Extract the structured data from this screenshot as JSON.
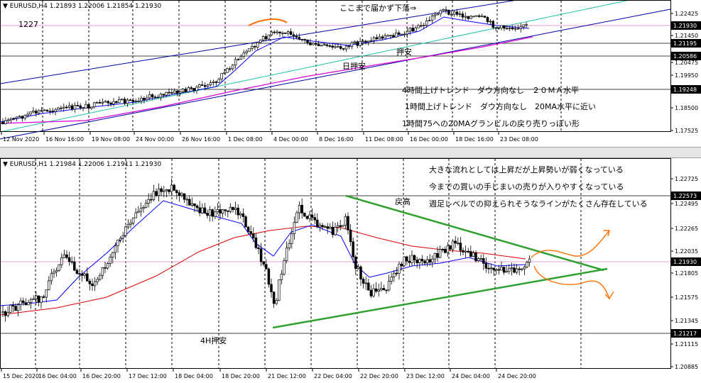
{
  "colors": {
    "candle": "#000000",
    "ma_short": "#0000ff",
    "ma_mid": "#dc0000",
    "ma_long": "#d400d4",
    "channel": "#0000a0",
    "mid_line": "#20c0a0",
    "triangle": "#30a030",
    "orange": "#ff7000",
    "current_line": "#e8a0d0",
    "hline": "#000000"
  },
  "top_chart": {
    "header": "▼ EURUSD,H4  1.21893 1.22006 1.21854 1.21930",
    "price_axis_labels": [
      "1.22425",
      "1.21930",
      "1.21450",
      "1.21195",
      "1.20586",
      "1.20475",
      "1.19950",
      "1.19248",
      "1.18500",
      "1.17525"
    ],
    "boxed_prices": [
      "1.21930",
      "1.21195",
      "1.20586",
      "1.19248"
    ],
    "time_labels": [
      "12 Nov 2020",
      "16 Nov 16:00",
      "19 Nov 08:00",
      "24 Nov 00:00",
      "26 Nov 16:00",
      "1 Dec 08:00",
      "4 Dec 00:00",
      "8 Dec 16:00",
      "11 Dec 08:00",
      "16 Dec 00:00",
      "18 Dec 16:00",
      "23 Dec 08:00"
    ],
    "annotations": {
      "top_note": "ここまで届かず下落⇒",
      "label_1227": "1227",
      "push_low": "押安",
      "daily_push_low": "日押安",
      "note1": "4時間上げトレンド　ダウ方向なし　２０ＭＡ水平",
      "note2": "1時間上げトレンド　ダウ方向なし　20MA水平に近い",
      "note3": "1時間75への20MAグランビルの戻り売りっぽい形"
    }
  },
  "bottom_chart": {
    "header": "▼ EURUSD,H1  1.21984 1.22006 1.21911 1.21930",
    "price_axis_labels": [
      "1.22725",
      "1.22573",
      "1.22495",
      "1.22265",
      "1.22035",
      "1.21930",
      "1.21805",
      "1.21575",
      "1.21345",
      "1.21217",
      "1.21115",
      "1.20885"
    ],
    "boxed_prices": [
      "1.22573",
      "1.21930",
      "1.21217"
    ],
    "time_labels": [
      "15 Dec 2020",
      "16 Dec 04:00",
      "16 Dec 20:00",
      "17 Dec 12:00",
      "18 Dec 04:00",
      "18 Dec 20:00",
      "21 Dec 12:00",
      "22 Dec 04:00",
      "22 Dec 20:00",
      "23 Dec 12:00",
      "24 Dec 04:00",
      "24 Dec 20:00"
    ],
    "annotations": {
      "return_high": "戻高",
      "h4_push_low": "4H押安",
      "note1": "大きな流れとしては上昇だが上昇勢いが弱くなっている",
      "note2": "今までの買いの手じまいの売りが入りやすくなっている",
      "note3": "週足レベルでの抑えられそうなラインがたくさん存在している"
    }
  }
}
